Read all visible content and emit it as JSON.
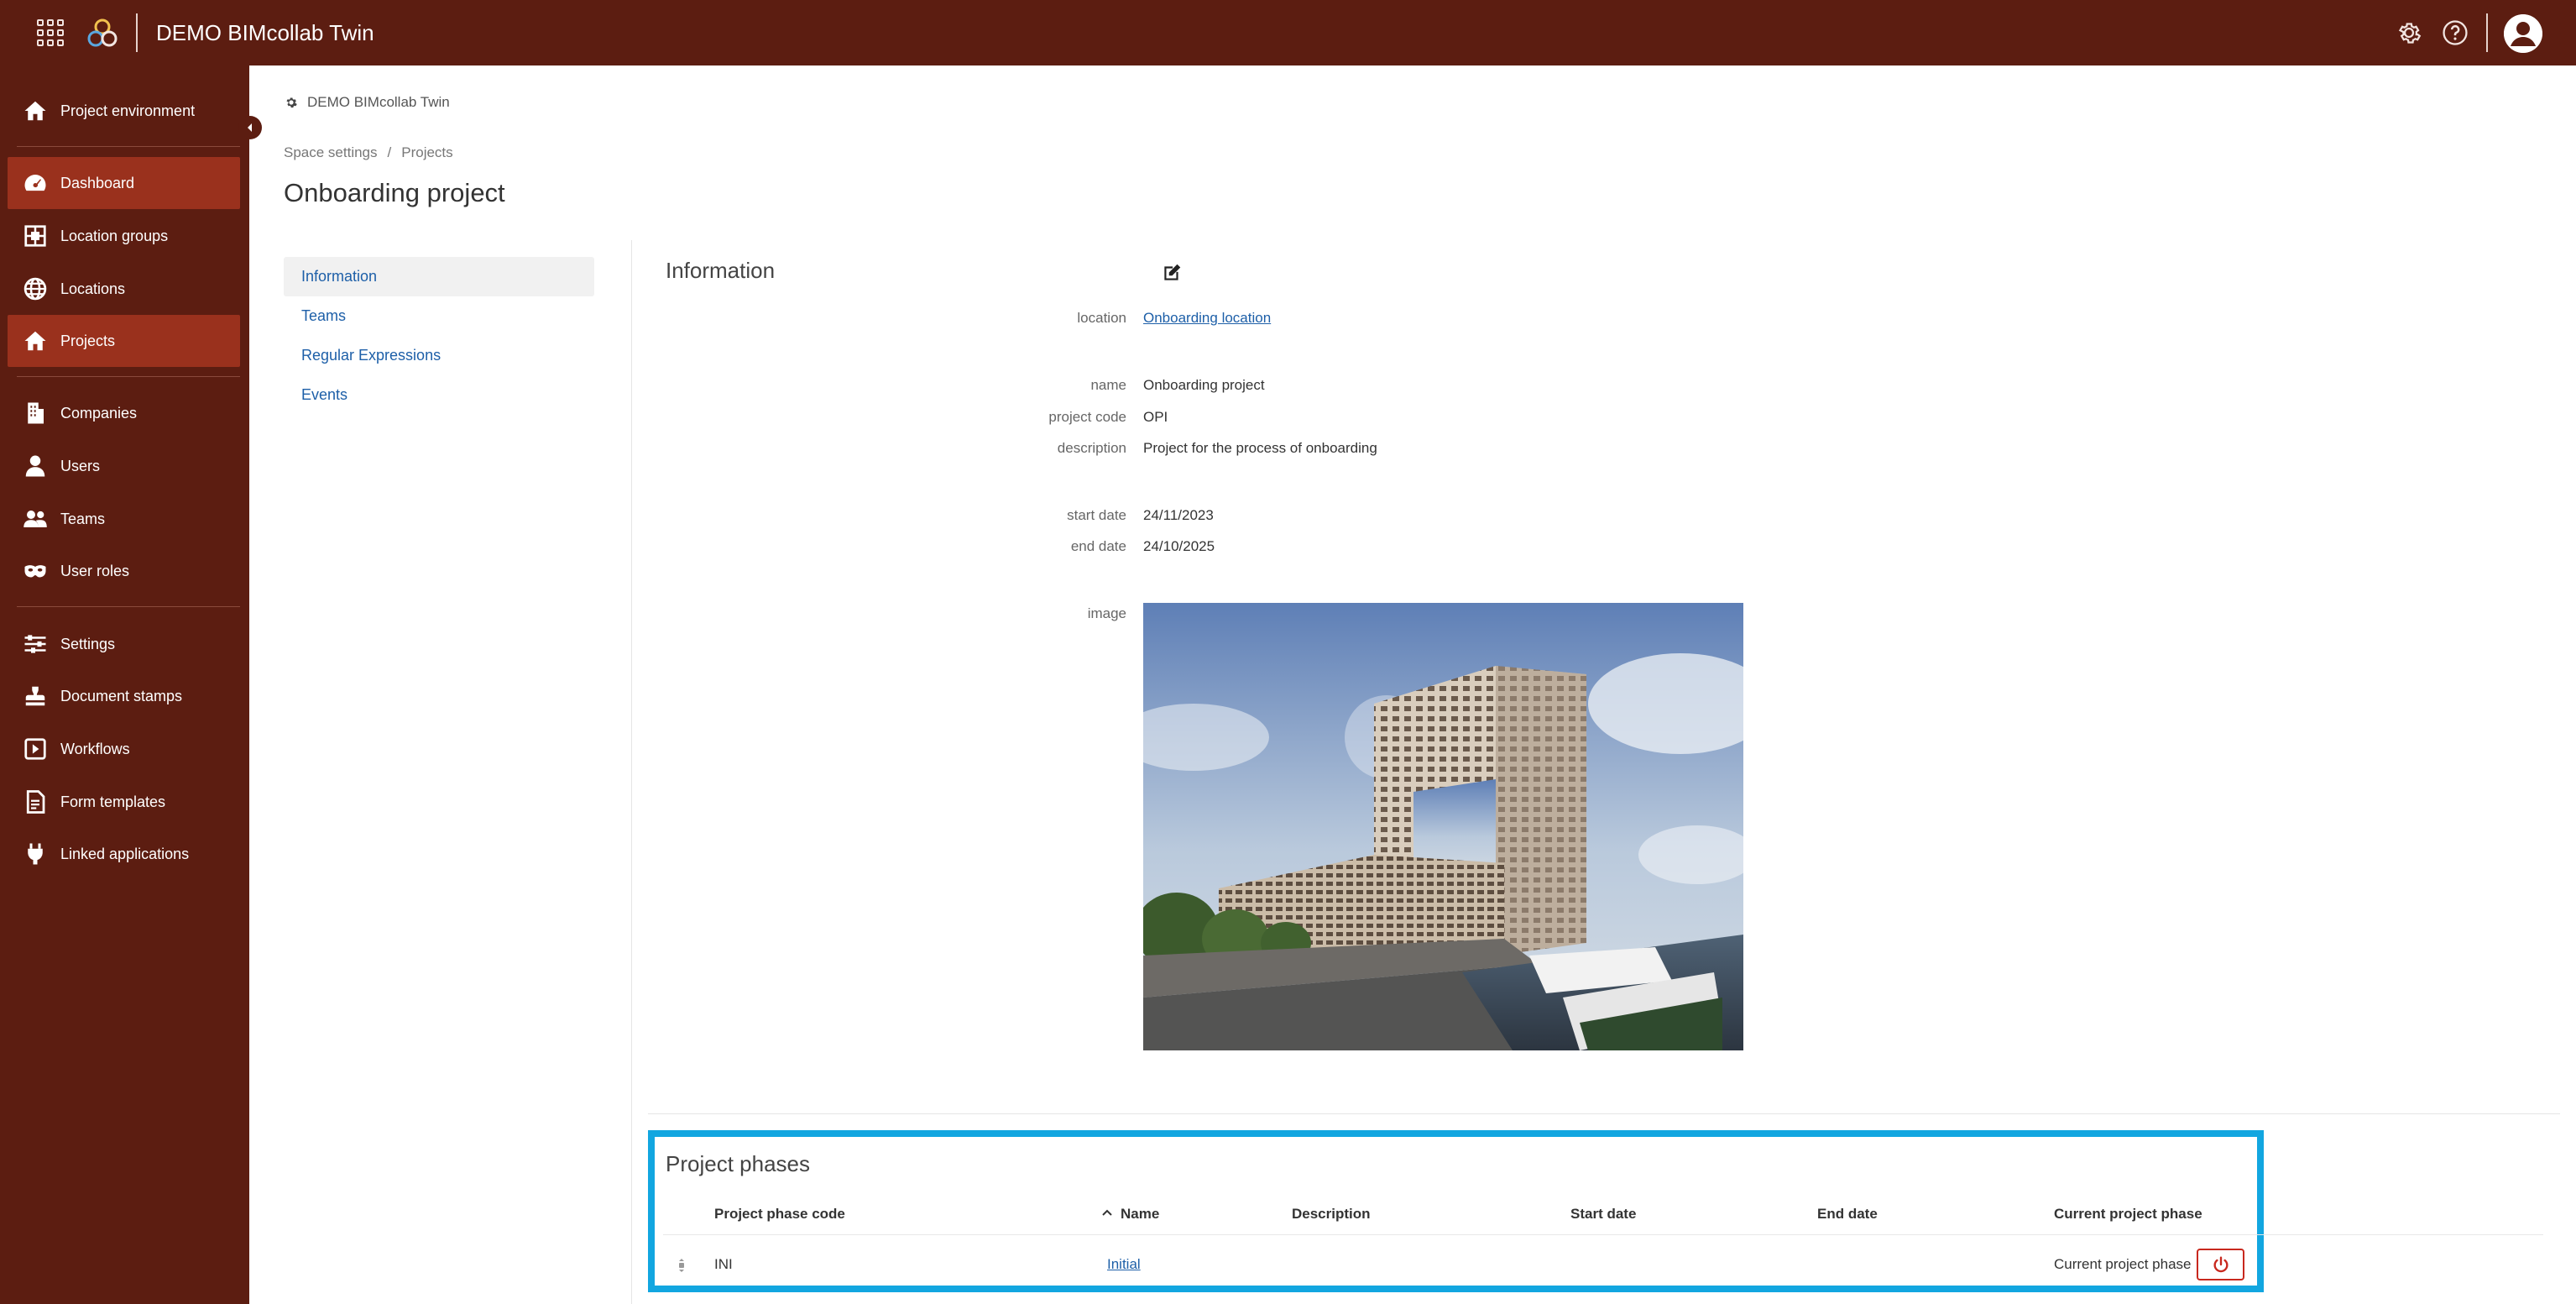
{
  "topbar": {
    "app_title": "DEMO BIMcollab Twin"
  },
  "sidebar": {
    "items": [
      {
        "label": "Project environment",
        "icon": "home-icon",
        "active": false
      },
      {
        "label": "Dashboard",
        "icon": "gauge-icon",
        "active": true
      },
      {
        "label": "Location groups",
        "icon": "location-groups-icon",
        "active": false
      },
      {
        "label": "Locations",
        "icon": "globe-icon",
        "active": false
      },
      {
        "label": "Projects",
        "icon": "home-icon",
        "active": true
      },
      {
        "label": "Companies",
        "icon": "building-icon",
        "active": false
      },
      {
        "label": "Users",
        "icon": "user-icon",
        "active": false
      },
      {
        "label": "Teams",
        "icon": "users-icon",
        "active": false
      },
      {
        "label": "User roles",
        "icon": "mask-icon",
        "active": false
      },
      {
        "label": "Settings",
        "icon": "sliders-icon",
        "active": false
      },
      {
        "label": "Document stamps",
        "icon": "stamp-icon",
        "active": false
      },
      {
        "label": "Workflows",
        "icon": "play-square-icon",
        "active": false
      },
      {
        "label": "Form templates",
        "icon": "file-icon",
        "active": false
      },
      {
        "label": "Linked applications",
        "icon": "plug-icon",
        "active": false
      }
    ]
  },
  "header": {
    "space_name": "DEMO BIMcollab Twin",
    "breadcrumb": [
      "Space settings",
      "Projects"
    ],
    "breadcrumb_sep": "/",
    "page_title": "Onboarding project"
  },
  "subnav": {
    "items": [
      "Information",
      "Teams",
      "Regular Expressions",
      "Events"
    ]
  },
  "information": {
    "title": "Information",
    "labels": {
      "location": "location",
      "name": "name",
      "project_code": "project code",
      "description": "description",
      "start_date": "start date",
      "end_date": "end date",
      "image": "image"
    },
    "values": {
      "location": "Onboarding location",
      "name": "Onboarding project",
      "project_code": "OPI",
      "description": "Project for the process of onboarding",
      "start_date": "24/11/2023",
      "end_date": "24/10/2025"
    }
  },
  "phases": {
    "title": "Project phases",
    "columns": [
      "Project phase code",
      "Name",
      "Description",
      "Start date",
      "End date",
      "Current project phase"
    ],
    "rows": [
      {
        "code": "INI",
        "name": "Initial",
        "description": "",
        "start": "",
        "end": "",
        "current": "Current project phase"
      }
    ]
  },
  "colors": {
    "brand": "#5c1d11",
    "active": "#9a311d",
    "link": "#1d5fa8",
    "highlight": "#12a6e0",
    "danger": "#c8281e"
  }
}
